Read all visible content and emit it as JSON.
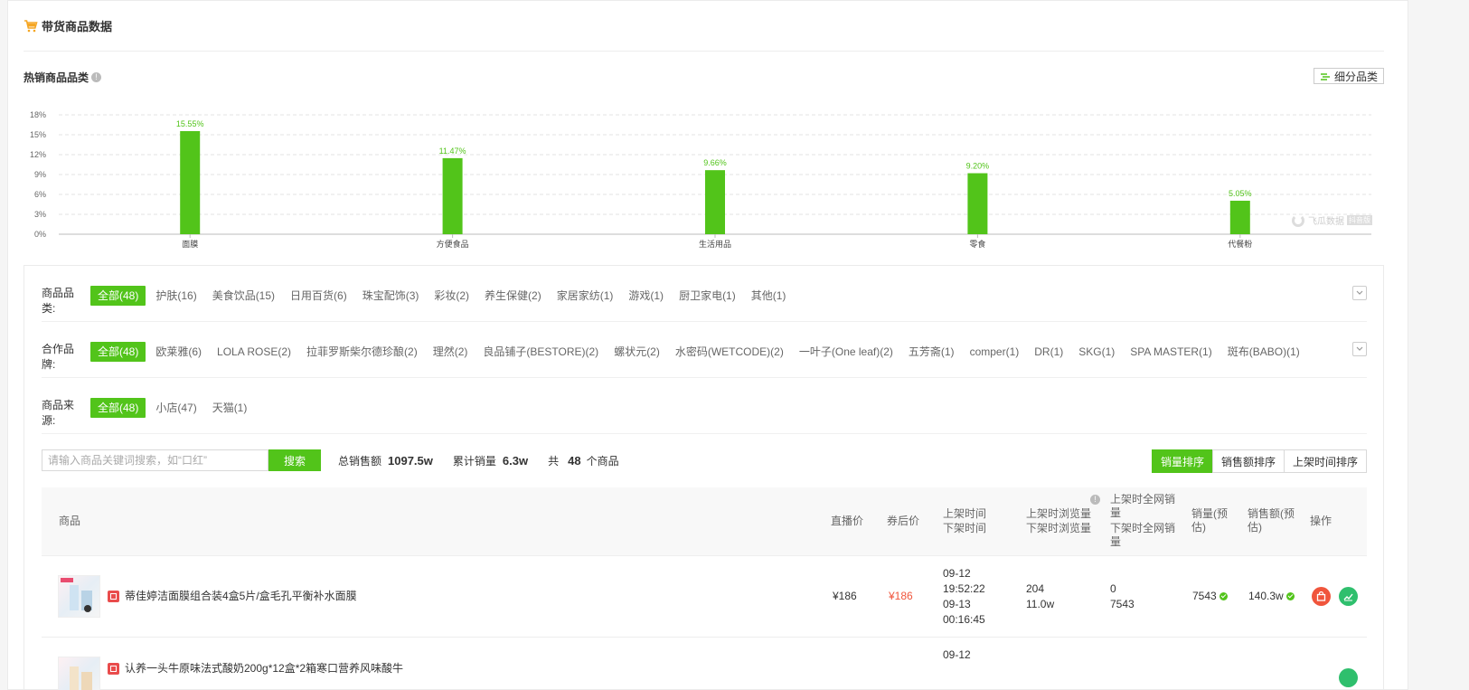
{
  "section": {
    "title": "带货商品数据"
  },
  "hot": {
    "title": "热销商品品类",
    "subcat_label": "细分品类"
  },
  "chart_data": {
    "type": "bar",
    "categories": [
      "面膜",
      "方便食品",
      "生活用品",
      "零食",
      "代餐粉"
    ],
    "values": [
      15.55,
      11.47,
      9.66,
      9.2,
      5.05
    ],
    "value_labels": [
      "15.55%",
      "11.47%",
      "9.66%",
      "9.20%",
      "5.05%"
    ],
    "yticks": [
      "0%",
      "3%",
      "6%",
      "9%",
      "12%",
      "15%",
      "18%"
    ],
    "ylim": [
      0,
      18
    ],
    "grid": true,
    "color": "#52c41a"
  },
  "watermark": {
    "text": "飞瓜数据",
    "badge": "抖音版"
  },
  "filters": {
    "category": {
      "label": "商品品类:",
      "options": [
        "全部(48)",
        "护肤(16)",
        "美食饮品(15)",
        "日用百货(6)",
        "珠宝配饰(3)",
        "彩妆(2)",
        "养生保健(2)",
        "家居家纺(1)",
        "游戏(1)",
        "厨卫家电(1)",
        "其他(1)"
      ]
    },
    "brand": {
      "label": "合作品牌:",
      "options": [
        "全部(48)",
        "欧莱雅(6)",
        "LOLA ROSE(2)",
        "拉菲罗斯柴尔德珍酿(2)",
        "理然(2)",
        "良品铺子(BESTORE)(2)",
        "螺状元(2)",
        "水密码(WETCODE)(2)",
        "一叶子(One leaf)(2)",
        "五芳斋(1)",
        "comper(1)",
        "DR(1)",
        "SKG(1)",
        "SPA MASTER(1)",
        "斑布(BABO)(1)"
      ]
    },
    "source": {
      "label": "商品来源:",
      "options": [
        "全部(48)",
        "小店(47)",
        "天猫(1)"
      ]
    }
  },
  "search": {
    "placeholder": "请输入商品关键词搜索，如“口红”",
    "button": "搜索",
    "total_sales_label": "总销售额",
    "total_sales": "1097.5w",
    "total_volume_label": "累计销量",
    "total_volume": "6.3w",
    "count_prefix": "共",
    "count": "48",
    "count_suffix": "个商品"
  },
  "sort": [
    "销量排序",
    "销售额排序",
    "上架时间排序"
  ],
  "table": {
    "headers": {
      "product": "商品",
      "live_price": "直播价",
      "coupon_price": "券后价",
      "time_on": "上架时间",
      "time_off": "下架时间",
      "views_on": "上架时浏览量",
      "views_off": "下架时浏览量",
      "net_on": "上架时全网销量",
      "net_off": "下架时全网销量",
      "sales": "销量(预估)",
      "revenue": "销售额(预估)",
      "ops": "操作"
    },
    "rows": [
      {
        "name": "蒂佳婷洁面膜组合装4盒5片/盒毛孔平衡补水面膜",
        "live_price": "¥186",
        "coupon_price": "¥186",
        "on_date": "09-12",
        "on_time": "19:52:22",
        "off_date": "09-13",
        "off_time": "00:16:45",
        "views_on": "204",
        "views_off": "11.0w",
        "net_on": "0",
        "net_off": "7543",
        "sales": "7543",
        "revenue": "140.3w"
      },
      {
        "name": "认养一头牛原味法式酸奶200g*12盒*2箱寒口营养风味酸牛",
        "on_date": "09-12"
      }
    ]
  }
}
